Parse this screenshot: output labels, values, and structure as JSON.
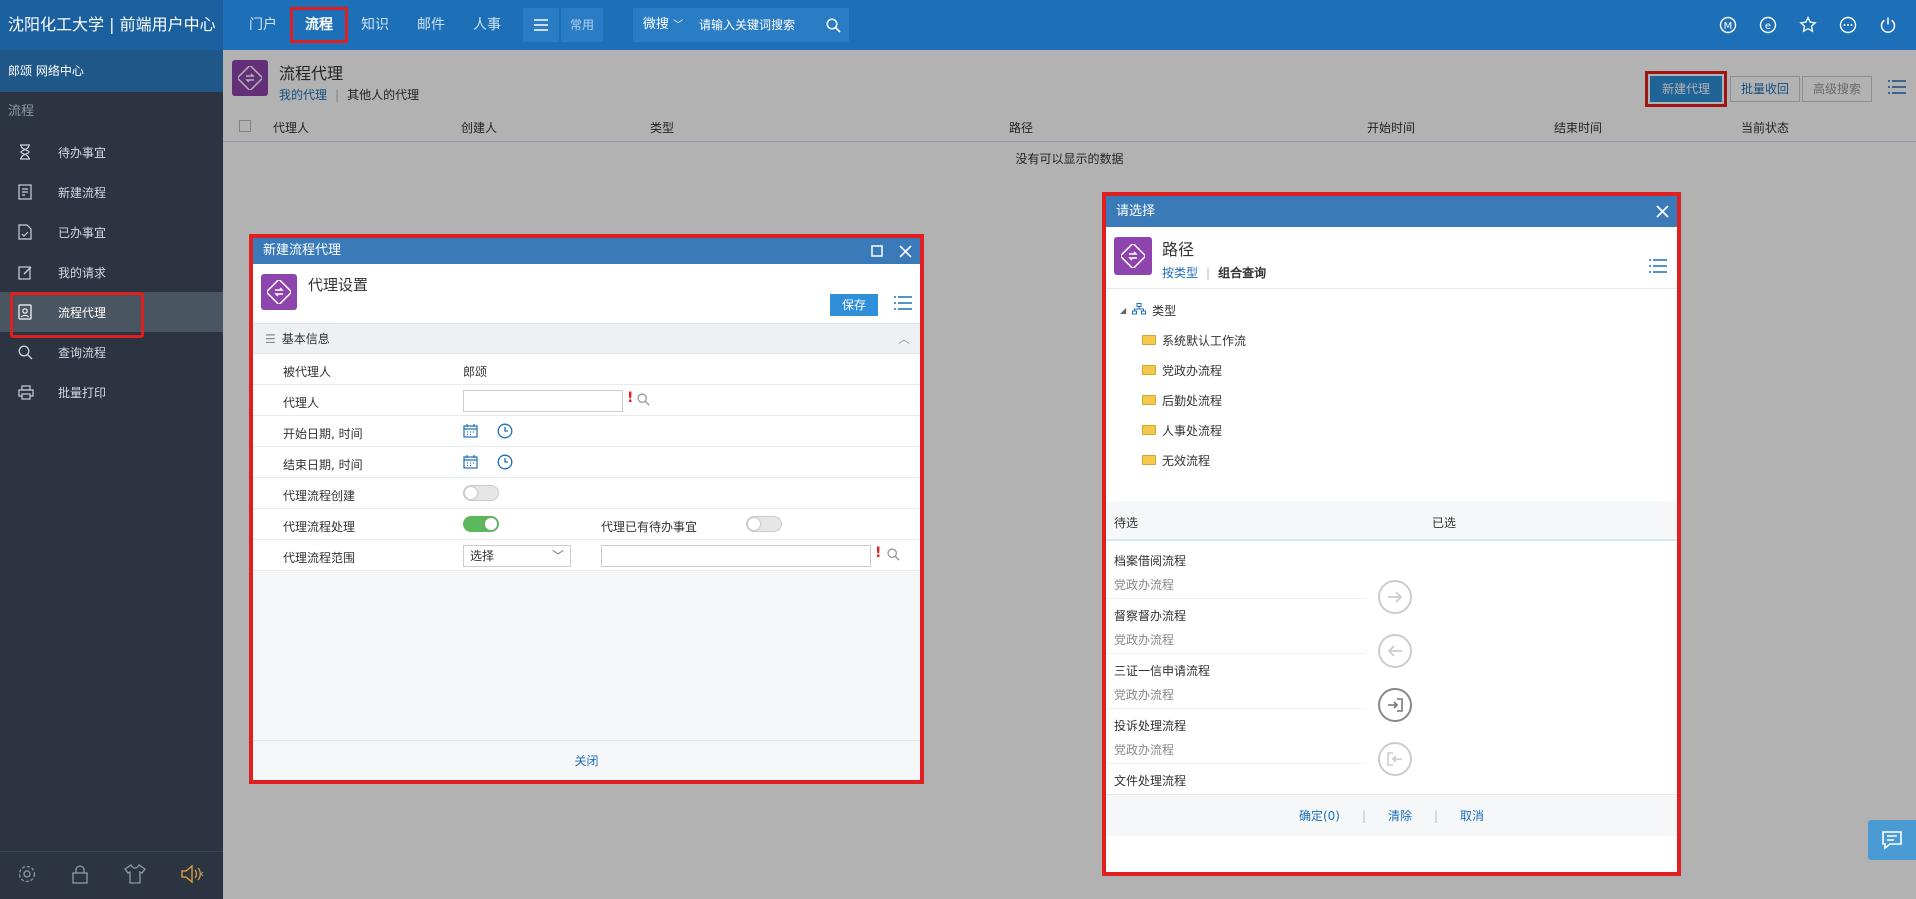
{
  "header": {
    "brand": "沈阳化工大学 | 前端用户中心",
    "nav": [
      "门户",
      "流程",
      "知识",
      "邮件",
      "人事"
    ],
    "active_nav": "流程",
    "common_label": "常用",
    "search_scope": "微搜",
    "search_placeholder": "请输入关键词搜索",
    "icons": [
      "m-circle-icon",
      "e-circle-icon",
      "star-icon",
      "more-icon",
      "power-icon"
    ]
  },
  "sidebar": {
    "user_line": "郎颂  网络中心",
    "section": "流程",
    "items": [
      {
        "label": "待办事宜",
        "icon": "hourglass-icon"
      },
      {
        "label": "新建流程",
        "icon": "new-doc-icon"
      },
      {
        "label": "已办事宜",
        "icon": "done-doc-icon"
      },
      {
        "label": "我的请求",
        "icon": "edit-icon"
      },
      {
        "label": "流程代理",
        "icon": "proxy-icon"
      },
      {
        "label": "查询流程",
        "icon": "search-icon"
      },
      {
        "label": "批量打印",
        "icon": "printer-icon"
      }
    ],
    "active": "流程代理",
    "bottom_icons": [
      "gear-icon",
      "lock-icon",
      "shirt-icon",
      "speaker-icon"
    ]
  },
  "page": {
    "title": "流程代理",
    "tabs": [
      "我的代理",
      "其他人的代理"
    ],
    "active_tab": "我的代理",
    "buttons": {
      "new": "新建代理",
      "batch_recall": "批量收回",
      "advanced": "高级搜索"
    },
    "columns": [
      "代理人",
      "创建人",
      "类型",
      "路径",
      "开始时间",
      "结束时间",
      "当前状态"
    ],
    "empty_text": "没有可以显示的数据"
  },
  "dialog_new": {
    "title": "新建流程代理",
    "subtitle": "代理设置",
    "save": "保存",
    "section": "基本信息",
    "fields": {
      "principal_label": "被代理人",
      "principal_value": "郎颂",
      "agent_label": "代理人",
      "start_label": "开始日期, 时间",
      "end_label": "结束日期, 时间",
      "create_label": "代理流程创建",
      "handle_label": "代理流程处理",
      "pending_label": "代理已有待办事宜",
      "scope_label": "代理流程范围",
      "scope_select": "选择"
    },
    "toggles": {
      "create": false,
      "handle": true,
      "pending": false
    },
    "close": "关闭"
  },
  "dialog_select": {
    "title": "请选择",
    "subtitle": "路径",
    "tabs": [
      "按类型",
      "组合查询"
    ],
    "active_tab": "按类型",
    "tree_root": "类型",
    "tree_items": [
      "系统默认工作流",
      "党政办流程",
      "后勤处流程",
      "人事处流程",
      "无效流程"
    ],
    "pending_header": "待选",
    "selected_header": "已选",
    "pending": [
      {
        "name": "档案借阅流程",
        "category": "党政办流程"
      },
      {
        "name": "督察督办流程",
        "category": "党政办流程"
      },
      {
        "name": "三证一信申请流程",
        "category": "党政办流程"
      },
      {
        "name": "投诉处理流程",
        "category": "党政办流程"
      },
      {
        "name": "文件处理流程",
        "category": ""
      }
    ],
    "footer": {
      "confirm": "确定(0)",
      "clear": "清除",
      "cancel": "取消"
    }
  }
}
